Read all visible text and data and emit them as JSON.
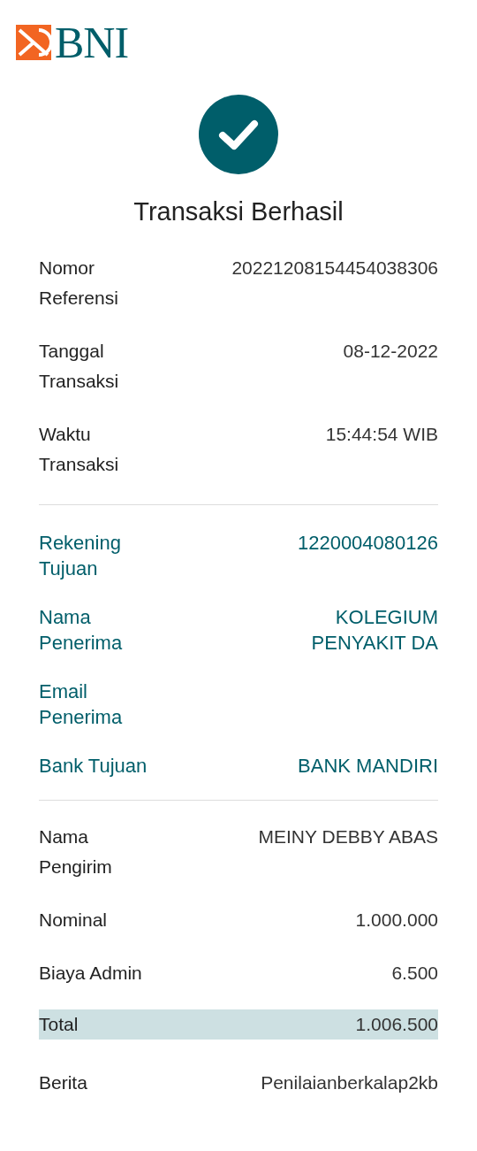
{
  "logo": {
    "text": "BNI"
  },
  "status": {
    "title": "Transaksi Berhasil"
  },
  "sections": [
    {
      "kind": "plain",
      "rows": [
        {
          "label": "Nomor\nReferensi",
          "value": "20221208154454038306",
          "highlighted": false
        },
        {
          "label": "Tanggal\nTransaksi",
          "value": "08-12-2022",
          "highlighted": false
        },
        {
          "label": "Waktu\nTransaksi",
          "value": "15:44:54 WIB",
          "highlighted": false
        }
      ]
    },
    {
      "kind": "accent",
      "rows": [
        {
          "label": "Rekening\nTujuan",
          "value": "1220004080126",
          "highlighted": false
        },
        {
          "label": "Nama\nPenerima",
          "value": "KOLEGIUM\nPENYAKIT DA",
          "highlighted": false
        },
        {
          "label": "Email\nPenerima",
          "highlighted": false
        },
        {
          "label": "Bank Tujuan",
          "value": "BANK MANDIRI",
          "highlighted": false
        }
      ]
    },
    {
      "kind": "plain",
      "rows": [
        {
          "label": "Nama\nPengirim",
          "value": "MEINY DEBBY ABAS",
          "highlighted": false
        },
        {
          "label": "Nominal",
          "value": "1.000.000",
          "highlighted": false
        },
        {
          "label": "Biaya Admin",
          "value": "6.500",
          "highlighted": false
        },
        {
          "label": "Total",
          "value": "1.006.500",
          "highlighted": true
        },
        {
          "label": "Berita",
          "value": "Penilaianberkalap2kb",
          "highlighted": false
        }
      ]
    }
  ]
}
